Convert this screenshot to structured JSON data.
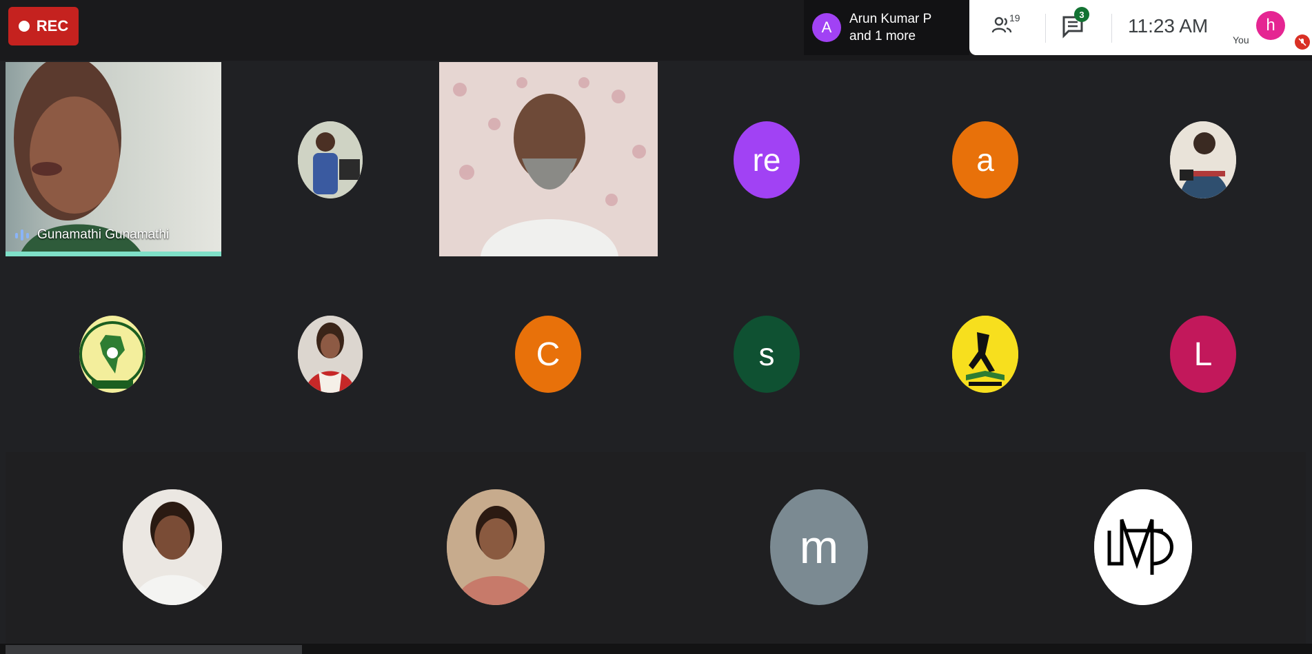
{
  "recording": {
    "label": "REC"
  },
  "presenter": {
    "initial": "A",
    "line1": "Arun Kumar P",
    "line2": "and 1 more"
  },
  "toolbar": {
    "participants_count": "19",
    "chat_badge": "3",
    "time": "11:23 AM",
    "self_label": "You",
    "self_initial": "h"
  },
  "colors": {
    "rec": "#c5221f",
    "presenter_avatar": "#a142f4",
    "self_avatar": "#e52592",
    "tile_re": "#a142f4",
    "tile_a": "#e8710a",
    "tile_c": "#e8710a",
    "tile_s": "#0f5132",
    "tile_l": "#c2185b",
    "tile_m": "#7b8a92"
  },
  "tiles": {
    "speaker_name": "Gunamathi Gunamathi",
    "re": "re",
    "a": "a",
    "c": "C",
    "s": "s",
    "l": "L",
    "m": "m"
  }
}
